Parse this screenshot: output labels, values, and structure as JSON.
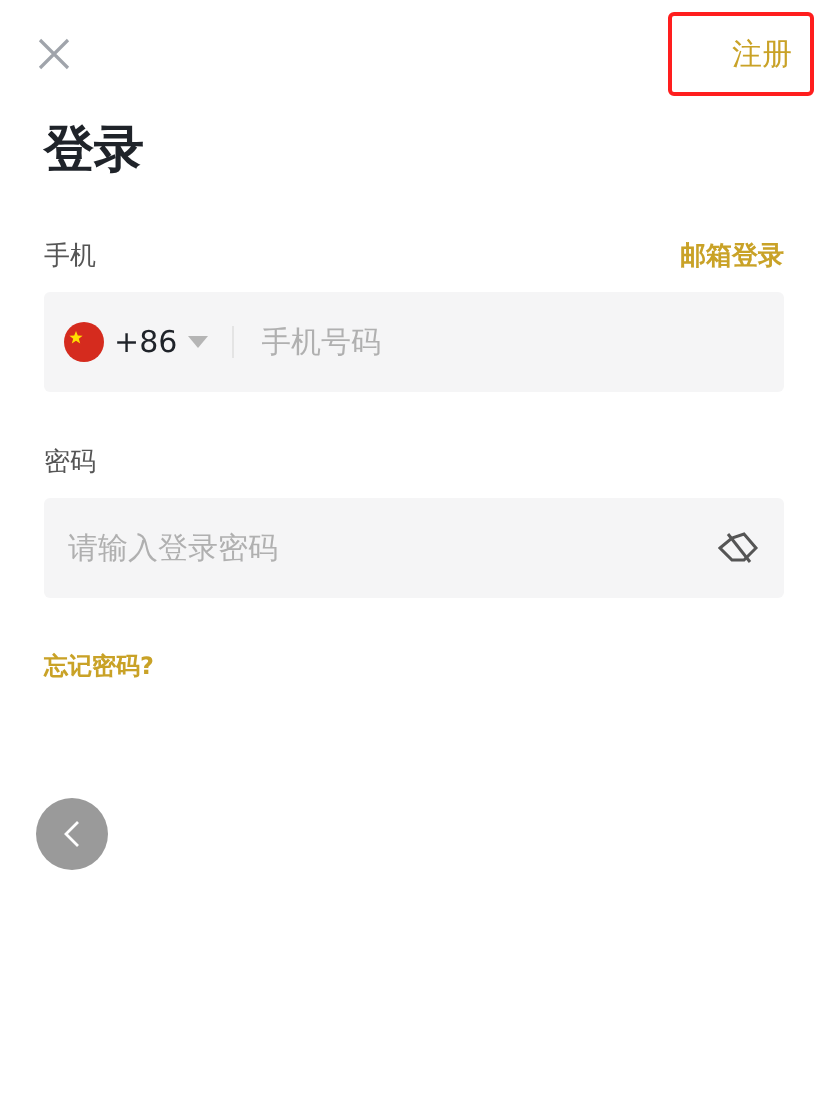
{
  "header": {
    "register": {
      "label": "注册",
      "highlighted": true
    }
  },
  "title": "登录",
  "phone": {
    "label": "手机",
    "switch_link": "邮箱登录",
    "country_code": "+86",
    "placeholder": "手机号码"
  },
  "password": {
    "label": "密码",
    "placeholder": "请输入登录密码",
    "visible": false
  },
  "forgot_link": "忘记密码?"
}
